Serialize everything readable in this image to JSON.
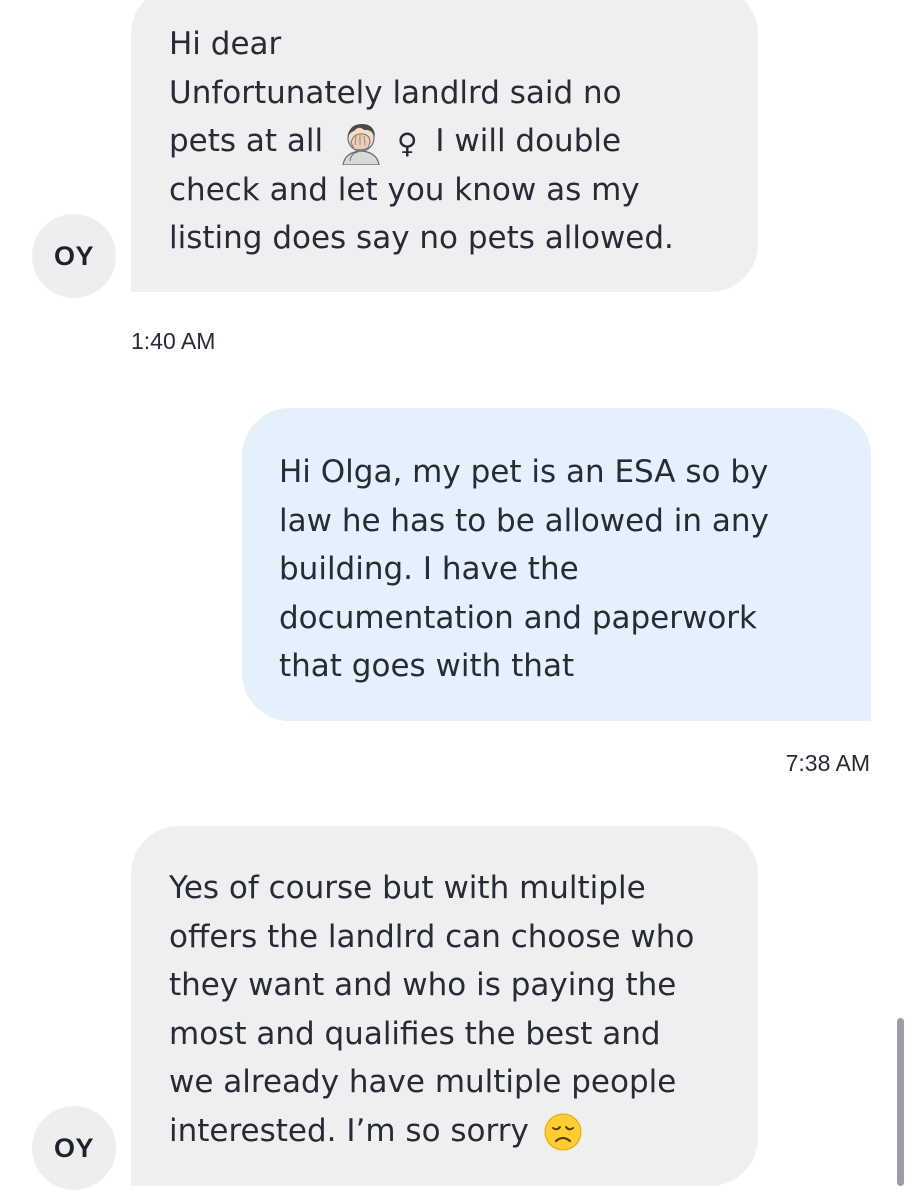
{
  "conversation": {
    "messages": [
      {
        "sender": "OY",
        "direction": "incoming",
        "lines": [
          "Hi dear",
          "Unfortunately landlrd said no",
          "pets at all",
          "I will double",
          "check and let you know as my",
          "listing does say no pets allowed."
        ],
        "inline_emoji": [
          "face-palm-emoji",
          "female-sign"
        ],
        "female_sign_char": "♀",
        "time": "1:40 AM"
      },
      {
        "direction": "outgoing",
        "lines": [
          "Hi Olga, my pet is an ESA so by",
          "law he has to be allowed in any",
          "building. I have the",
          "documentation and paperwork",
          "that goes with that"
        ],
        "time": "7:38 AM"
      },
      {
        "sender": "OY",
        "direction": "incoming",
        "lines": [
          "Yes of course but with multiple",
          "offers the landlrd can choose who",
          "they want and who is paying the",
          "most and qualifies the best and",
          "we already have multiple people",
          "interested. I’m so sorry"
        ],
        "inline_emoji": [
          "disappointed-face-emoji"
        ]
      }
    ]
  },
  "colors": {
    "incoming_bubble": "#efeff2",
    "outgoing_bubble": "#e4f0fb",
    "avatar_bg": "#eeeef1",
    "text": "#262b36"
  }
}
